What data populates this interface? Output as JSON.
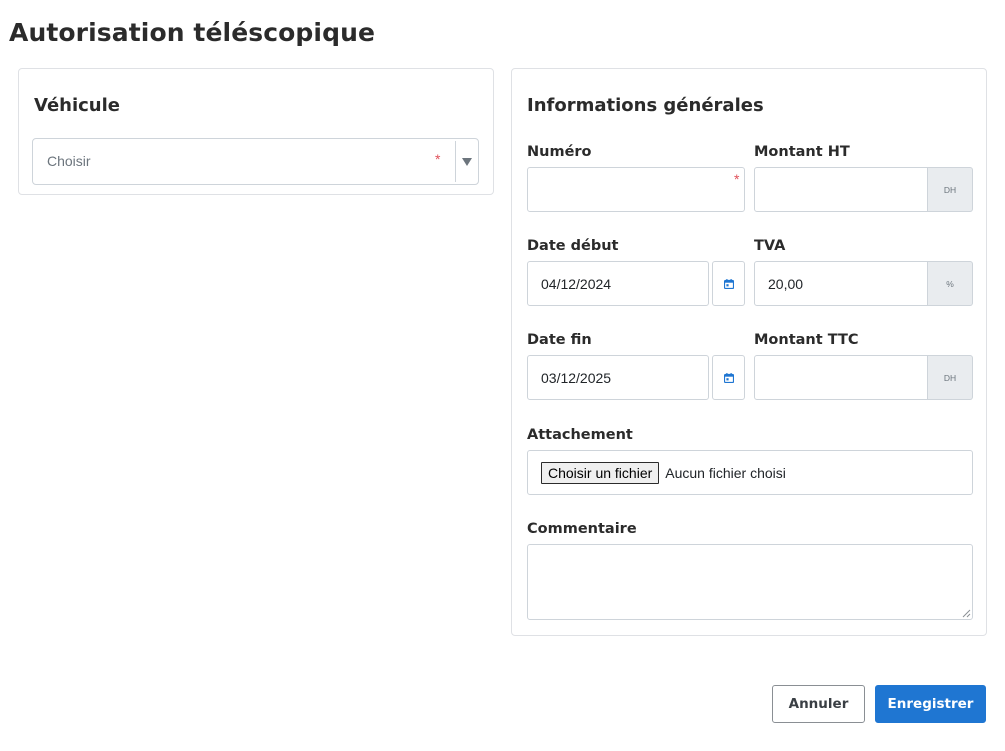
{
  "page": {
    "title": "Autorisation téléscopique"
  },
  "vehicle": {
    "title": "Véhicule",
    "select": {
      "placeholder": "Choisir",
      "required_mark": "*"
    }
  },
  "info": {
    "title": "Informations générales",
    "numero": {
      "label": "Numéro",
      "value": "",
      "required_mark": "*"
    },
    "montant_ht": {
      "label": "Montant HT",
      "value": "",
      "unit": "DH"
    },
    "date_debut": {
      "label": "Date début",
      "value": "04/12/2024"
    },
    "tva": {
      "label": "TVA",
      "value": "20,00",
      "unit": "%"
    },
    "date_fin": {
      "label": "Date fin",
      "value": "03/12/2025"
    },
    "montant_ttc": {
      "label": "Montant TTC",
      "value": "",
      "unit": "DH"
    },
    "attachement": {
      "label": "Attachement",
      "button_label": "Choisir un fichier",
      "status": "Aucun fichier choisi"
    },
    "commentaire": {
      "label": "Commentaire",
      "value": ""
    }
  },
  "icons": {
    "calendar": "calendar-icon",
    "dropdown": "caret-down-icon"
  },
  "colors": {
    "primary": "#1f76d2",
    "required": "#e0505a",
    "addon_bg": "#e9ecef",
    "border": "#ced4da"
  },
  "actions": {
    "cancel_label": "Annuler",
    "save_label": "Enregistrer"
  }
}
